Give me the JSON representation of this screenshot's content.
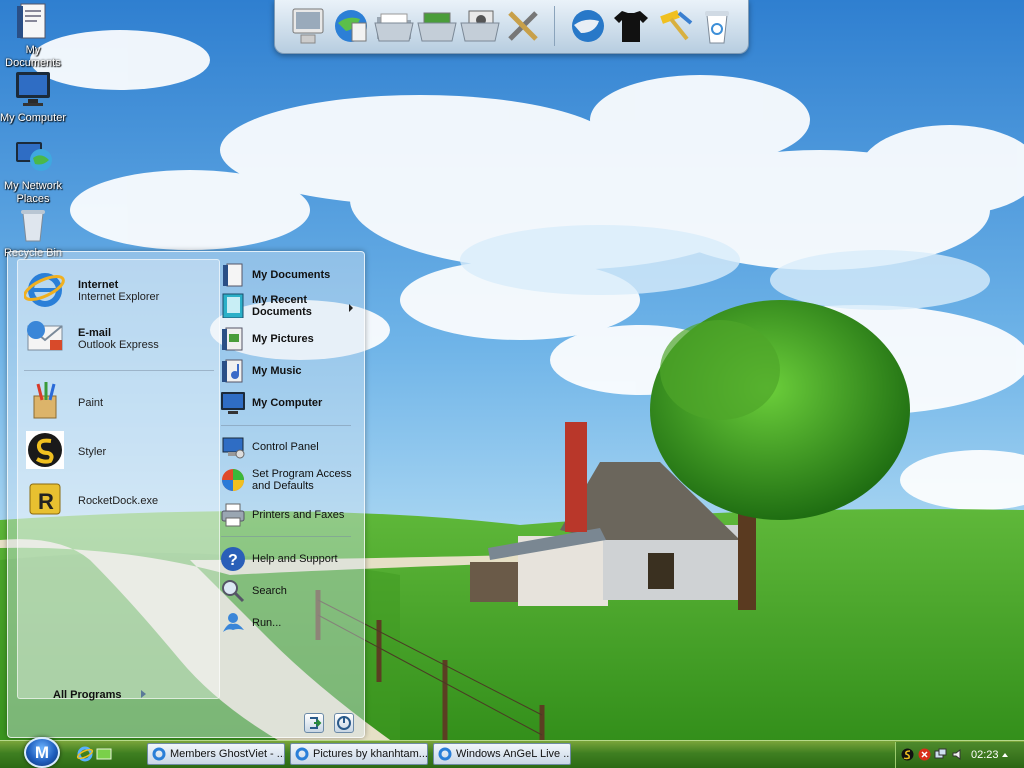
{
  "desktop": {
    "icons": [
      {
        "label": "My Documents",
        "icon": "my-documents-icon"
      },
      {
        "label": "My Computer",
        "icon": "monitor-icon"
      },
      {
        "label": "My Network Places",
        "icon": "network-globe-icon"
      },
      {
        "label": "Recycle Bin",
        "icon": "recycle-bin-icon"
      }
    ]
  },
  "dock": {
    "items": [
      "computer-icon",
      "globe-icon",
      "folder-icon",
      "folder-pictures-icon",
      "folder-photo-icon",
      "tools-icon",
      "globe-network-icon",
      "tshirt-icon",
      "hammer-icon",
      "recycle-bin-icon"
    ]
  },
  "start_menu": {
    "pinned": [
      {
        "title": "Internet",
        "subtitle": "Internet Explorer",
        "icon": "internet-explorer-icon"
      },
      {
        "title": "E-mail",
        "subtitle": "Outlook Express",
        "icon": "email-icon"
      }
    ],
    "recent": [
      {
        "label": "Paint",
        "icon": "paint-icon"
      },
      {
        "label": "Styler",
        "icon": "styler-icon"
      },
      {
        "label": "RocketDock.exe",
        "icon": "rocketdock-icon"
      }
    ],
    "all_programs": "All Programs",
    "places": [
      {
        "label": "My Documents",
        "icon": "my-documents-icon"
      },
      {
        "label": "My Recent Documents",
        "icon": "recent-documents-icon"
      },
      {
        "label": "My Pictures",
        "icon": "my-pictures-icon"
      },
      {
        "label": "My Music",
        "icon": "my-music-icon"
      },
      {
        "label": "My Computer",
        "icon": "my-computer-icon"
      }
    ],
    "settings": [
      {
        "label": "Control Panel",
        "icon": "control-panel-icon"
      },
      {
        "label": "Set Program Access and Defaults",
        "icon": "program-access-icon"
      },
      {
        "label": "Printers and Faxes",
        "icon": "printer-icon"
      }
    ],
    "help": [
      {
        "label": "Help and Support",
        "icon": "help-icon"
      },
      {
        "label": "Search",
        "icon": "search-icon"
      },
      {
        "label": "Run...",
        "icon": "run-icon"
      }
    ]
  },
  "taskbar": {
    "start_label": "M",
    "tasks": [
      {
        "label": "Members GhostViet - ...",
        "icon": "internet-explorer-icon"
      },
      {
        "label": "Pictures by khanhtam...",
        "icon": "internet-explorer-icon"
      },
      {
        "label": "Windows AnGeL Live ...",
        "icon": "internet-explorer-icon"
      }
    ],
    "clock": "02:23"
  },
  "colors": {
    "sky": "#5aa0dc",
    "grass": "#4ba22a",
    "taskbar": "#3f7f21",
    "start_orb": "#1f5fbf"
  }
}
